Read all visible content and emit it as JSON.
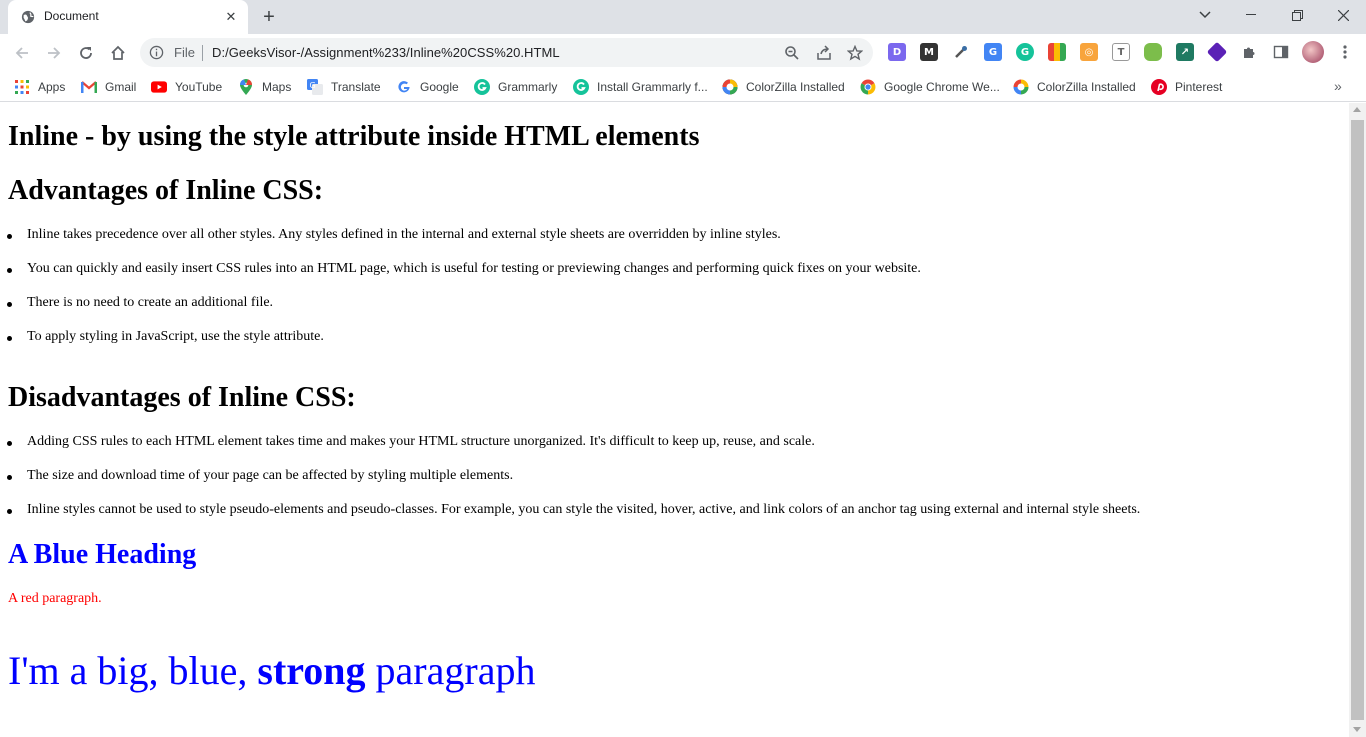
{
  "tab": {
    "title": "Document",
    "close": "✕"
  },
  "window": {
    "new_tab": "+"
  },
  "address": {
    "scheme_label": "File",
    "url": "D:/GeeksVisor-/Assignment%233/Inline%20CSS%20.HTML"
  },
  "bookmarks": [
    {
      "label": "Apps",
      "icon": "apps-grid-icon"
    },
    {
      "label": "Gmail",
      "icon": "gmail-icon"
    },
    {
      "label": "YouTube",
      "icon": "youtube-icon"
    },
    {
      "label": "Maps",
      "icon": "maps-icon"
    },
    {
      "label": "Translate",
      "icon": "translate-icon"
    },
    {
      "label": "Google",
      "icon": "google-icon"
    },
    {
      "label": "Grammarly",
      "icon": "grammarly-icon"
    },
    {
      "label": "Install Grammarly f...",
      "icon": "grammarly-icon"
    },
    {
      "label": "ColorZilla Installed",
      "icon": "colorzilla-icon"
    },
    {
      "label": "Google Chrome We...",
      "icon": "chrome-icon"
    },
    {
      "label": "ColorZilla Installed",
      "icon": "colorzilla-icon"
    },
    {
      "label": "Pinterest",
      "icon": "pinterest-icon"
    }
  ],
  "bookmarks_more": "»",
  "page": {
    "h1": "Inline - by using the style attribute inside HTML elements",
    "advantages_heading": "Advantages of Inline CSS:",
    "advantages": [
      "Inline takes precedence over all other styles. Any styles defined in the internal and external style sheets are overridden by inline styles.",
      "You can quickly and easily insert CSS rules into an HTML page, which is useful for testing or previewing changes and performing quick fixes on your website.",
      "There is no need to create an additional file.",
      "To apply styling in JavaScript, use the style attribute."
    ],
    "disadvantages_heading": "Disadvantages of Inline CSS:",
    "disadvantages": [
      "Adding CSS rules to each HTML element takes time and makes your HTML structure unorganized. It's difficult to keep up, reuse, and scale.",
      "The size and download time of your page can be affected by styling multiple elements.",
      "Inline styles cannot be used to style pseudo-elements and pseudo-classes. For example, you can style the visited, hover, active, and link colors of an anchor tag using external and internal style sheets."
    ],
    "blue_heading": "A Blue Heading",
    "red_paragraph": "A red paragraph.",
    "big_paragraph_before": "I'm a big, blue, ",
    "big_paragraph_strong": "strong",
    "big_paragraph_after": " paragraph"
  },
  "colors": {
    "blue": "#0000ff",
    "red": "#ff0000",
    "tabstrip": "#dee1e6"
  }
}
